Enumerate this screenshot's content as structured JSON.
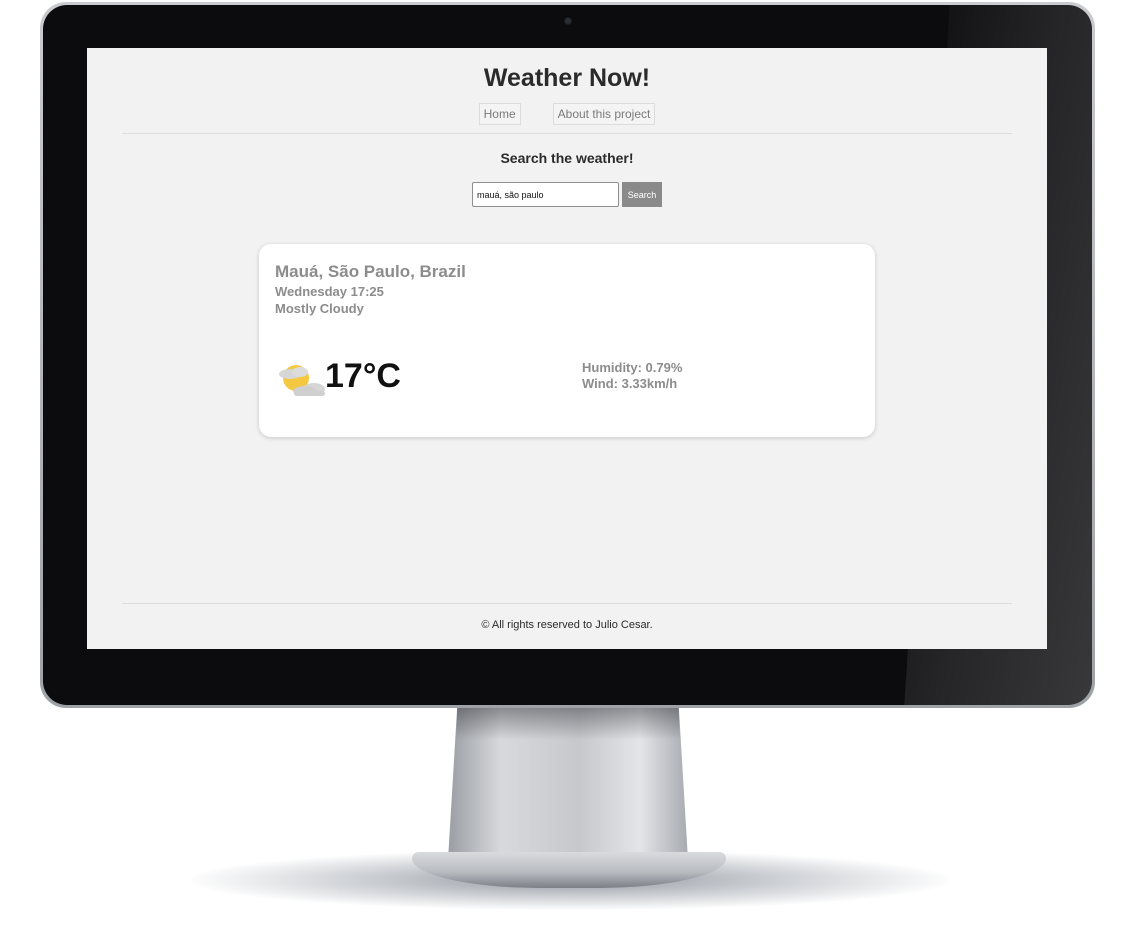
{
  "header": {
    "title": "Weather Now!",
    "nav": [
      {
        "label": "Home"
      },
      {
        "label": "About this project"
      }
    ]
  },
  "search": {
    "heading": "Search the weather!",
    "input_value": "mauá, são paulo",
    "button_label": "Search"
  },
  "weather": {
    "location": "Mauá, São Paulo, Brazil",
    "datetime": "Wednesday 17:25",
    "condition": "Mostly Cloudy",
    "icon": "partly-cloudy-icon",
    "temperature": "17°C",
    "humidity": "Humidity: 0.79%",
    "wind": "Wind: 3.33km/h"
  },
  "footer": {
    "text": "© All rights reserved to Julio Cesar."
  },
  "colors": {
    "page_background": "#f2f2f2",
    "card_background": "#ffffff",
    "search_button": "#8a8a8a",
    "muted_text": "#8c8c8c",
    "sun": "#f5c842",
    "cloud": "#d6d6d6"
  }
}
